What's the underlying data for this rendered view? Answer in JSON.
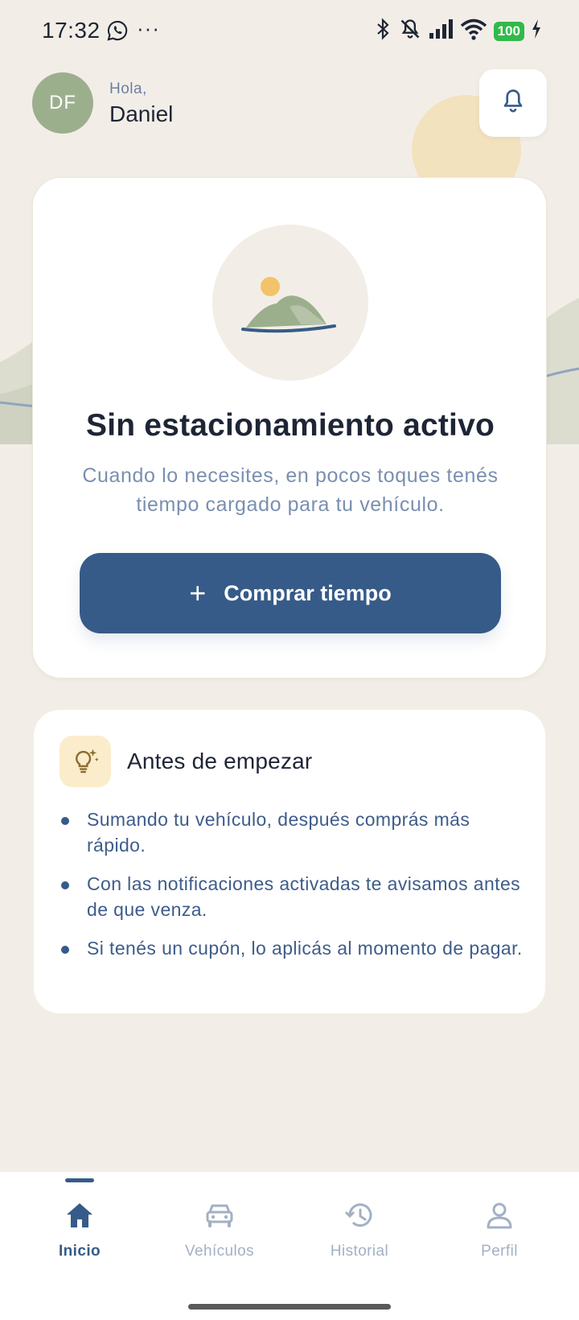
{
  "status": {
    "time": "17:32",
    "battery": "100"
  },
  "header": {
    "initials": "DF",
    "greeting": "Hola,",
    "name": "Daniel"
  },
  "main_card": {
    "title": "Sin estacionamiento activo",
    "description": "Cuando lo necesites, en pocos toques tenés tiempo cargado para tu vehículo.",
    "button_label": "Comprar tiempo",
    "button_icon": "+"
  },
  "tips": {
    "title": "Antes de empezar",
    "items": [
      "Sumando tu vehículo, después comprás más rápido.",
      "Con las notificaciones activadas te avisamos antes de que venza.",
      "Si tenés un cupón, lo aplicás al momento de pagar."
    ]
  },
  "nav": {
    "items": [
      {
        "label": "Inicio",
        "icon": "home-icon",
        "active": true
      },
      {
        "label": "Vehículos",
        "icon": "car-icon",
        "active": false
      },
      {
        "label": "Historial",
        "icon": "history-icon",
        "active": false
      },
      {
        "label": "Perfil",
        "icon": "person-icon",
        "active": false
      }
    ]
  },
  "colors": {
    "primary": "#365b88",
    "background": "#f2eee7",
    "avatar": "#9caf8d",
    "accent": "#f3c36a"
  }
}
